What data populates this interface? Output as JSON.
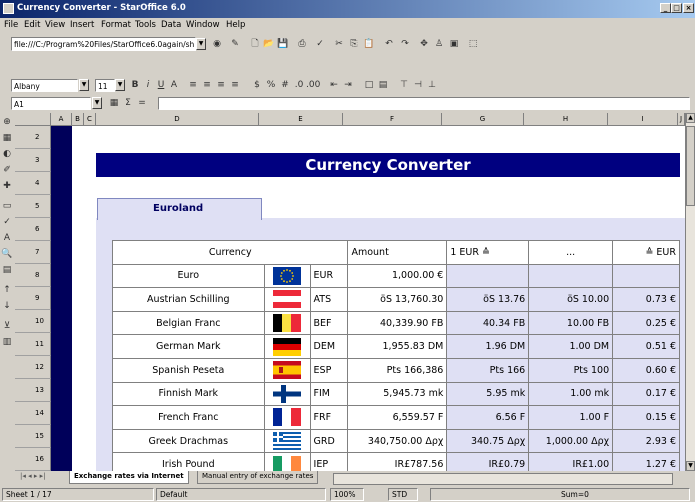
{
  "window": {
    "title": "Currency Converter - StarOffice 6.0",
    "min": "_",
    "max": "□",
    "close": "×"
  },
  "menu": [
    "File",
    "Edit",
    "View",
    "Insert",
    "Format",
    "Tools",
    "Data",
    "Window",
    "Help"
  ],
  "url": {
    "value": "file:///C:/Program%20Files/StarOffice6.0again/sh"
  },
  "format": {
    "font": "Albany",
    "size": "11"
  },
  "formula": {
    "cellref": "A1",
    "value": ""
  },
  "columns": [
    "A",
    "B",
    "C",
    "D",
    "E",
    "F",
    "G",
    "H",
    "I",
    "J"
  ],
  "rows": [
    "2",
    "3",
    "4",
    "5",
    "6",
    "7",
    "8",
    "9",
    "10",
    "11",
    "12",
    "13",
    "14",
    "15",
    "16"
  ],
  "sheet": {
    "title": "Currency Converter",
    "tab_label": "Euroland",
    "headers": {
      "currency": "Currency",
      "amount": "Amount",
      "eur_to": "1 EUR ≙",
      "dots": "...",
      "to_eur": "≙ EUR"
    },
    "rows": [
      {
        "name": "Euro",
        "code": "EUR",
        "amount": "1,000.00 €",
        "rate": "",
        "unit": "",
        "eur": "",
        "flag": "eu"
      },
      {
        "name": "Austrian Schilling",
        "code": "ATS",
        "amount": "öS 13,760.30",
        "rate": "öS 13.76",
        "unit": "öS 10.00",
        "eur": "0.73 €",
        "flag": "at"
      },
      {
        "name": "Belgian Franc",
        "code": "BEF",
        "amount": "40,339.90 FB",
        "rate": "40.34 FB",
        "unit": "10.00 FB",
        "eur": "0.25 €",
        "flag": "be"
      },
      {
        "name": "German Mark",
        "code": "DEM",
        "amount": "1,955.83 DM",
        "rate": "1.96 DM",
        "unit": "1.00 DM",
        "eur": "0.51 €",
        "flag": "de"
      },
      {
        "name": "Spanish Peseta",
        "code": "ESP",
        "amount": "Pts 166,386",
        "rate": "Pts 166",
        "unit": "Pts 100",
        "eur": "0.60 €",
        "flag": "es"
      },
      {
        "name": "Finnish Mark",
        "code": "FIM",
        "amount": "5,945.73 mk",
        "rate": "5.95 mk",
        "unit": "1.00 mk",
        "eur": "0.17 €",
        "flag": "fi"
      },
      {
        "name": "French Franc",
        "code": "FRF",
        "amount": "6,559.57 F",
        "rate": "6.56 F",
        "unit": "1.00 F",
        "eur": "0.15 €",
        "flag": "fr"
      },
      {
        "name": "Greek Drachmas",
        "code": "GRD",
        "amount": "340,750.00 Δρχ",
        "rate": "340.75 Δρχ",
        "unit": "1,000.00 Δρχ",
        "eur": "2.93 €",
        "flag": "gr"
      },
      {
        "name": "Irish Pound",
        "code": "IEP",
        "amount": "IR£787.56",
        "rate": "IR£0.79",
        "unit": "IR£1.00",
        "eur": "1.27 €",
        "flag": "ie"
      }
    ]
  },
  "tabs": [
    "Exchange rates via Internet",
    "Manual entry of exchange rates"
  ],
  "status": {
    "sheet": "Sheet 1 / 17",
    "style": "Default",
    "zoom": "100%",
    "mode": "STD",
    "sum": "Sum=0"
  }
}
